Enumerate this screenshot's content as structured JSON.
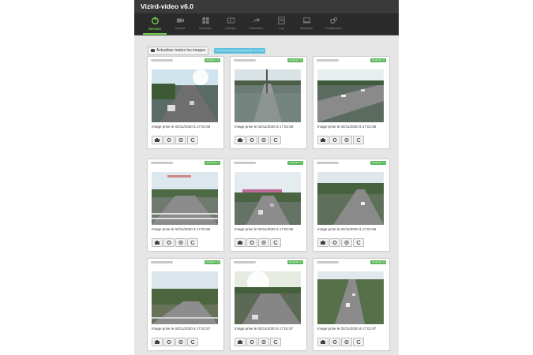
{
  "app": {
    "title": "Vizird-video v6.0"
  },
  "nav": {
    "items": [
      {
        "label": "Service",
        "icon": "power-icon",
        "active": true
      },
      {
        "label": "Caméra",
        "icon": "video-camera-icon",
        "active": false
      },
      {
        "label": "Mosaïque",
        "icon": "grid-icon",
        "active": false
      },
      {
        "label": "Cyclique",
        "icon": "cycle-icon",
        "active": false
      },
      {
        "label": "Publication",
        "icon": "share-icon",
        "active": false
      },
      {
        "label": "Log",
        "icon": "log-icon",
        "active": false
      },
      {
        "label": "Historique",
        "icon": "history-icon",
        "active": false
      },
      {
        "label": "Configuration",
        "icon": "gears-icon",
        "active": false
      }
    ]
  },
  "toolbar": {
    "refresh_label": "Actualiser toutes les images",
    "update_badge": "Service lancé depuis le 02/11/2020 à 17:01:00"
  },
  "colors": {
    "accent": "#6fcf4a",
    "status_ok": "#5cb85c",
    "info": "#5bc0de",
    "nav_bg": "#2a2a2a"
  },
  "cameras": [
    {
      "status": "caméra1 - 0",
      "caption": "Image prise le 02/11/2020 à 17:01:56"
    },
    {
      "status": "caméra2 - 0",
      "caption": "Image prise le 02/11/2020 à 17:01:56"
    },
    {
      "status": "caméra3 - 0",
      "caption": "Image prise le 02/11/2020 à 17:01:56"
    },
    {
      "status": "caméra4 - 0",
      "caption": "Image prise le 02/11/2020 à 17:01:56"
    },
    {
      "status": "caméra5 - 0",
      "caption": "Image prise le 02/11/2020 à 17:01:56"
    },
    {
      "status": "caméra6 - 0",
      "caption": "Image prise le 02/11/2020 à 17:01:56"
    },
    {
      "status": "caméra7 - 0",
      "caption": "Image prise le 02/11/2020 à 17:01:57"
    },
    {
      "status": "caméra8 - 0",
      "caption": "Image prise le 02/11/2020 à 17:01:57"
    },
    {
      "status": "caméra9 - 0",
      "caption": "Image prise le 02/11/2020 à 17:01:57"
    }
  ]
}
